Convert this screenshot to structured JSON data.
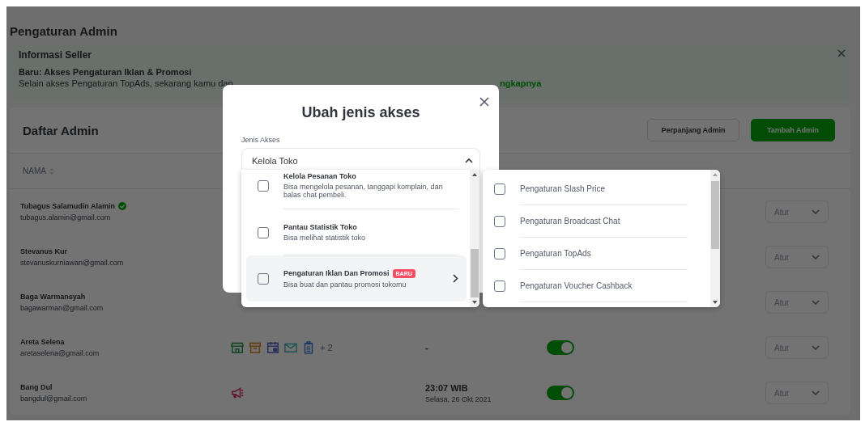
{
  "page": {
    "title": "Pengaturan Admin"
  },
  "info_banner": {
    "heading": "Informasi Seller",
    "title": "Baru: Akses Pengaturan Iklan & Promosi",
    "text": "Selain akses Pengaturan TopAds, sekarang kamu dap",
    "link": "ngkapnya"
  },
  "admin_list": {
    "title": "Daftar Admin",
    "buttons": [
      {
        "label": "Perpanjang Admin",
        "kind": "outline"
      },
      {
        "label": "Tambah Admin",
        "kind": "primary"
      }
    ],
    "columns": [
      "NAMA"
    ],
    "rows": [
      {
        "name": "Tubagus Salamudin Alamin",
        "verified": true,
        "email": "tubagus.alamin@gmail.com",
        "action": "Atur"
      },
      {
        "name": "Stevanus Kur",
        "verified": false,
        "email": "stevanuskurniawan@gmail.com",
        "action": "Atur"
      },
      {
        "name": "Baga Warmansyah",
        "verified": false,
        "email": "bagawarman@gmail.com",
        "action": "Atur"
      },
      {
        "name": "Areta Selena",
        "verified": false,
        "email": "aretaselena@gmail.com",
        "access_icons": [
          {
            "kind": "store"
          },
          {
            "kind": "box"
          },
          {
            "kind": "calendar"
          },
          {
            "kind": "mail"
          },
          {
            "kind": "clipboard"
          }
        ],
        "access_more": "+ 2",
        "time": "-",
        "on": true,
        "action": "Atur"
      },
      {
        "name": "Bang Dul",
        "verified": false,
        "email": "bangdul@gmail.com",
        "access_icons": [
          {
            "kind": "megaphone"
          }
        ],
        "time": "23:07 WIB",
        "date": "Selasa, 26 Okt 2021",
        "on": true,
        "action": "Atur"
      }
    ]
  },
  "modal": {
    "title": "Ubah jenis akses",
    "field_label": "Jenis Akses",
    "field_value": "Kelola Toko",
    "expanded": true,
    "options": [
      {
        "title": "Kelola Pesanan Toko",
        "description": "Bisa mengelola pesanan, tanggapi komplain, dan balas chat pembeli.",
        "checked": false,
        "selected": false
      },
      {
        "title": "Pantau Statistik Toko",
        "description": "Bisa melihat statistik toko",
        "checked": false,
        "selected": false
      },
      {
        "title": "Pengaturan Iklan Dan Promosi",
        "badge": "BARU",
        "description": "Bisa buat dan pantau promosi tokomu",
        "checked": false,
        "selected": true
      }
    ],
    "sub_options": [
      {
        "label": "Pengaturan Slash Price",
        "checked": false
      },
      {
        "label": "Pengaturan Broadcast Chat",
        "checked": false
      },
      {
        "label": "Pengaturan TopAds",
        "checked": false
      },
      {
        "label": "Pengaturan Voucher Cashback",
        "checked": false
      }
    ]
  }
}
